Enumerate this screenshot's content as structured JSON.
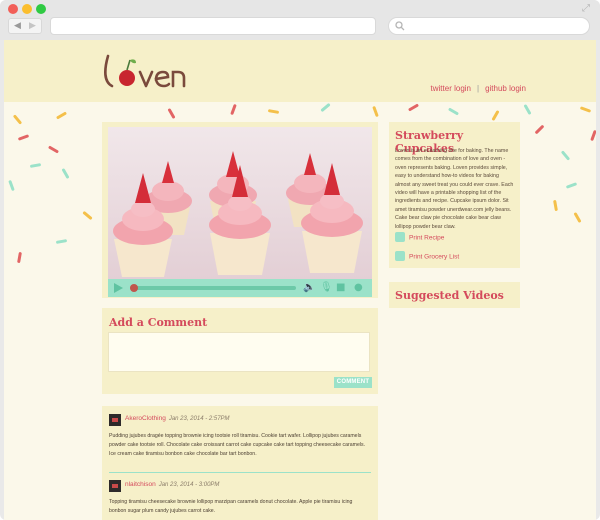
{
  "browser": {
    "window_controls": [
      "close",
      "minimize",
      "maximize"
    ],
    "expand_icon": "expand-icon",
    "nav": {
      "back": "◀",
      "forward": "▶"
    },
    "search_icon": "search-icon"
  },
  "header": {
    "logo_text": "lcven",
    "links": {
      "twitter": "twitter login",
      "separator": "|",
      "github": "github login"
    }
  },
  "video": {
    "controls": [
      "play-icon",
      "progress-bar",
      "volume-icon",
      "mic-icon",
      "camera-icon",
      "record-icon"
    ],
    "progress": 0.0
  },
  "comment_form": {
    "heading": "Add a Comment",
    "button": "COMMENT"
  },
  "comments": [
    {
      "author": "AkeroClothing",
      "date": "Jan 23, 2014 - 2:57PM",
      "body": "Pudding jujubes dragée topping brownie icing tootsie roll tiramisu. Cookie tart wafer. Lollipop jujubes caramels powder cake tootsie roll. Chocolate cake croissant carrot cake cupcake cake tart topping cheesecake caramels. Ice cream cake tiramisu bonbon cake chocolate bar tart bonbon."
    },
    {
      "author": "nlaitchison",
      "date": "Jan 23, 2014 - 3:00PM",
      "body": "Topping tiramisu cheesecake brownie lollipop marzipan caramels donut chocolate. Apple pie tiramisu icing bonbon sugar plum candy jujubes carrot cake."
    }
  ],
  "recipe": {
    "title": "Strawberry Cupcakes",
    "description": "Loven is an eLearning site for baking. The name comes from the combination of love and oven - oven represents baking. Loven provides simple, easy to understand how-to videos for baking almost any sweet treat you could ever crave. Each video will have a printable shopping list of the ingredients and recipe. Cupcake ipsum dolor. Sit amet tiramisu powder unerdwear.com jelly beans. Cake bear claw pie chocolate cake bear claw lollipop powder bear claw.",
    "links": [
      {
        "label": "Print Recipe",
        "icon": "print-icon"
      },
      {
        "label": "Print Grocery List",
        "icon": "print-icon"
      }
    ]
  },
  "suggested": {
    "heading": "Suggested Videos"
  },
  "colors": {
    "accent": "#d44a5c",
    "mint": "#9be2c9",
    "cream": "#f6f0c9",
    "page": "#fbf8ea"
  }
}
